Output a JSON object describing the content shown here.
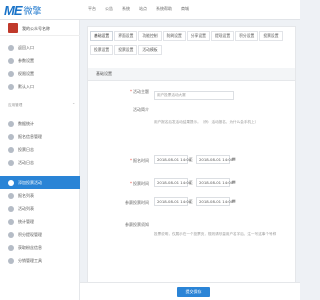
{
  "brand": {
    "mark": "ME",
    "name": "微擎"
  },
  "topnav": [
    "平台",
    "公告",
    "系统",
    "站点",
    "系统帮助",
    "商城"
  ],
  "sidebar": {
    "account_name": "我的公众号名称",
    "items": [
      {
        "label": "返回入口"
      },
      {
        "label": "参数设置"
      },
      {
        "label": "权限设置"
      },
      {
        "label": "默认入口"
      }
    ],
    "section_label": "应用管理",
    "apps": [
      {
        "label": "数据统计"
      },
      {
        "label": "报名信息管理"
      },
      {
        "label": "投票日志"
      },
      {
        "label": "活动日志"
      },
      {
        "label": "添加投票活动"
      },
      {
        "label": "报名列表"
      },
      {
        "label": "活动列表"
      },
      {
        "label": "统计管理"
      },
      {
        "label": "积分提现管理"
      },
      {
        "label": "获取粉丝信息"
      },
      {
        "label": "分销管理工具"
      }
    ]
  },
  "tabs_row1": [
    "基础设置",
    "界面设置",
    "功能控制",
    "防刷设置",
    "分享设置",
    "提现设置",
    "积分设置",
    "投票设置"
  ],
  "tabs_row2": [
    "投票设置",
    "投票设置",
    "活动模板"
  ],
  "section_title": "基础设置",
  "form": {
    "activity_name": {
      "label": "活动主题",
      "value": "用户投票活动大赛"
    },
    "activity_intro": {
      "label": "活动简介",
      "hint": "用户报名后发活动结果提示。（例：活动报名，为什么会手机上）"
    },
    "signup_time": {
      "label": "报名时间",
      "start": "2018-08-01 14:00",
      "sep": "至",
      "end": "2018-08-01 14:00"
    },
    "vote_time": {
      "label": "投票时间",
      "start": "2018-08-01 14:00",
      "sep": "至",
      "end": "2018-08-01 14:00"
    },
    "extra_time": {
      "label": "参赛投票时间",
      "start": "2018-08-01 14:00",
      "sep": "至",
      "end": "2018-08-01 14:00"
    },
    "vote_notice": {
      "label": "参赛投票须知",
      "hint": "投票说明，仅展示在一个投票页，规则请尽量用户名字后，注一写这事个号称"
    }
  },
  "footer": {
    "save_label": "提交保存"
  },
  "colors": {
    "accent": "#2a84d6",
    "required": "#e74c3c"
  }
}
